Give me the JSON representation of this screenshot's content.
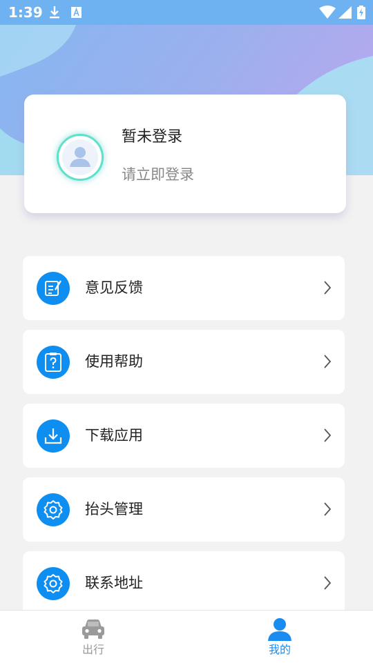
{
  "status_bar": {
    "time": "1:39",
    "icons": [
      "download-icon",
      "text-icon",
      "wifi-icon",
      "signal-icon",
      "battery-icon"
    ]
  },
  "colors": {
    "accent": "#0f8ef2",
    "status_bar": "#6fb2f2",
    "background": "#f2f2f2",
    "tab_active": "#1a8cf0",
    "tab_inactive": "#999999"
  },
  "user_card": {
    "name": "暂未登录",
    "subtitle": "请立即登录"
  },
  "menu": [
    {
      "label": "意见反馈",
      "icon": "feedback-icon"
    },
    {
      "label": "使用帮助",
      "icon": "help-icon"
    },
    {
      "label": "下载应用",
      "icon": "download-app-icon"
    },
    {
      "label": "抬头管理",
      "icon": "gear-icon"
    },
    {
      "label": "联系地址",
      "icon": "gear-icon"
    }
  ],
  "tabs": [
    {
      "label": "出行",
      "icon": "car-icon",
      "active": false
    },
    {
      "label": "我的",
      "icon": "person-icon",
      "active": true
    }
  ]
}
